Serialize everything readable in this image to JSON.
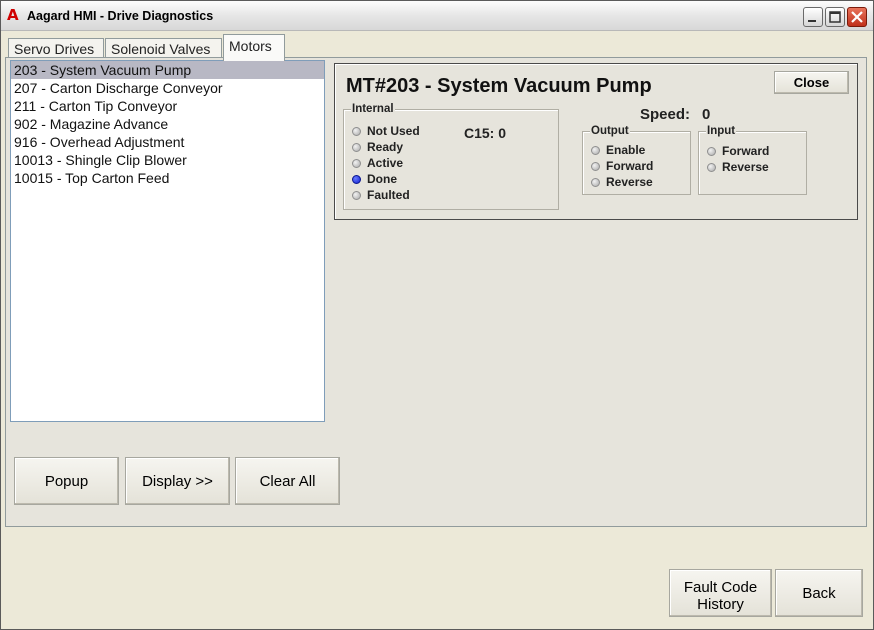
{
  "window": {
    "title": "Aagard HMI - Drive Diagnostics",
    "logo_letter": "A",
    "controls": [
      "minimize-icon",
      "maximize-icon",
      "close-icon"
    ]
  },
  "tabs": [
    {
      "label": "Servo Drives"
    },
    {
      "label": "Solenoid Valves"
    },
    {
      "label": "Motors",
      "active": true
    }
  ],
  "motor_list": [
    {
      "label": "203 - System Vacuum Pump",
      "selected": true
    },
    {
      "label": "207 - Carton Discharge Conveyor"
    },
    {
      "label": "211 - Carton Tip Conveyor"
    },
    {
      "label": "902 - Magazine Advance"
    },
    {
      "label": "916 - Overhead Adjustment"
    },
    {
      "label": "10013 - Shingle Clip Blower"
    },
    {
      "label": "10015 - Top Carton Feed"
    }
  ],
  "list_buttons": {
    "popup": "Popup",
    "display": "Display >>",
    "clear_all": "Clear All"
  },
  "detail": {
    "title": "MT#203 - System Vacuum Pump",
    "close_label": "Close",
    "speed_label": "Speed:",
    "speed_value": "0",
    "internal": {
      "label": "Internal",
      "c15": "C15: 0",
      "items": [
        {
          "label": "Not Used",
          "on": false
        },
        {
          "label": "Ready",
          "on": false
        },
        {
          "label": "Active",
          "on": false
        },
        {
          "label": "Done",
          "on": true
        },
        {
          "label": "Faulted",
          "on": false
        }
      ]
    },
    "output": {
      "label": "Output",
      "items": [
        {
          "label": "Enable",
          "on": false
        },
        {
          "label": "Forward",
          "on": false
        },
        {
          "label": "Reverse",
          "on": false
        }
      ]
    },
    "input": {
      "label": "Input",
      "items": [
        {
          "label": "Forward",
          "on": false
        },
        {
          "label": "Reverse",
          "on": false
        }
      ]
    }
  },
  "footer": {
    "fault_history": "Fault Code History",
    "back": "Back"
  },
  "colors": {
    "indicator_on": "#1020d0",
    "indicator_off": "#b0b0b0",
    "selection": "#b8b8c4"
  }
}
